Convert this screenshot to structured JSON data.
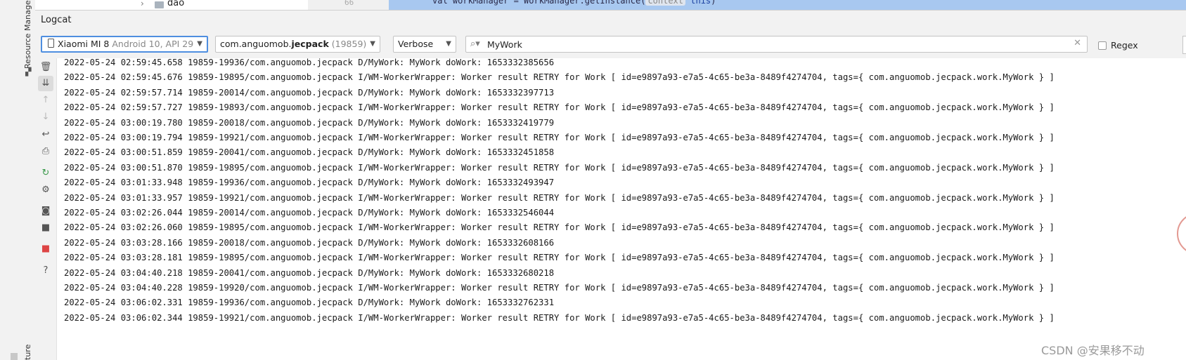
{
  "project_tree": {
    "item_label": "dao"
  },
  "editor": {
    "code_prefix": "val workManager = WorkManager.getInstance(",
    "param_hint": "context",
    "code_arg": "this",
    "code_suffix": ")"
  },
  "sidebar": {
    "resource_manager_label": "Resource Manager",
    "structure_label": "ture"
  },
  "logcat": {
    "title": "Logcat",
    "device": {
      "name": "Xiaomi MI 8",
      "details": "Android 10, API 29"
    },
    "app": {
      "package_prefix": "com.anguomob.",
      "package_bold": "jecpack",
      "pid": "(19859)"
    },
    "level": "Verbose",
    "filter_value": "MyWork",
    "regex_label": "Regex",
    "regex_checked": false,
    "lines": [
      "2022-05-24 02:59:45.658 19859-19936/com.anguomob.jecpack D/MyWork: MyWork doWork: 1653332385656",
      "2022-05-24 02:59:45.676 19859-19895/com.anguomob.jecpack I/WM-WorkerWrapper: Worker result RETRY for Work [ id=e9897a93-e7a5-4c65-be3a-8489f4274704, tags={ com.anguomob.jecpack.work.MyWork } ]",
      "2022-05-24 02:59:57.714 19859-20014/com.anguomob.jecpack D/MyWork: MyWork doWork: 1653332397713",
      "2022-05-24 02:59:57.727 19859-19893/com.anguomob.jecpack I/WM-WorkerWrapper: Worker result RETRY for Work [ id=e9897a93-e7a5-4c65-be3a-8489f4274704, tags={ com.anguomob.jecpack.work.MyWork } ]",
      "2022-05-24 03:00:19.780 19859-20018/com.anguomob.jecpack D/MyWork: MyWork doWork: 1653332419779",
      "2022-05-24 03:00:19.794 19859-19921/com.anguomob.jecpack I/WM-WorkerWrapper: Worker result RETRY for Work [ id=e9897a93-e7a5-4c65-be3a-8489f4274704, tags={ com.anguomob.jecpack.work.MyWork } ]",
      "2022-05-24 03:00:51.859 19859-20041/com.anguomob.jecpack D/MyWork: MyWork doWork: 1653332451858",
      "2022-05-24 03:00:51.870 19859-19895/com.anguomob.jecpack I/WM-WorkerWrapper: Worker result RETRY for Work [ id=e9897a93-e7a5-4c65-be3a-8489f4274704, tags={ com.anguomob.jecpack.work.MyWork } ]",
      "2022-05-24 03:01:33.948 19859-19936/com.anguomob.jecpack D/MyWork: MyWork doWork: 1653332493947",
      "2022-05-24 03:01:33.957 19859-19921/com.anguomob.jecpack I/WM-WorkerWrapper: Worker result RETRY for Work [ id=e9897a93-e7a5-4c65-be3a-8489f4274704, tags={ com.anguomob.jecpack.work.MyWork } ]",
      "2022-05-24 03:02:26.044 19859-20014/com.anguomob.jecpack D/MyWork: MyWork doWork: 1653332546044",
      "2022-05-24 03:02:26.060 19859-19895/com.anguomob.jecpack I/WM-WorkerWrapper: Worker result RETRY for Work [ id=e9897a93-e7a5-4c65-be3a-8489f4274704, tags={ com.anguomob.jecpack.work.MyWork } ]",
      "2022-05-24 03:03:28.166 19859-20018/com.anguomob.jecpack D/MyWork: MyWork doWork: 1653332608166",
      "2022-05-24 03:03:28.181 19859-19895/com.anguomob.jecpack I/WM-WorkerWrapper: Worker result RETRY for Work [ id=e9897a93-e7a5-4c65-be3a-8489f4274704, tags={ com.anguomob.jecpack.work.MyWork } ]",
      "2022-05-24 03:04:40.218 19859-20041/com.anguomob.jecpack D/MyWork: MyWork doWork: 1653332680218",
      "2022-05-24 03:04:40.228 19859-19920/com.anguomob.jecpack I/WM-WorkerWrapper: Worker result RETRY for Work [ id=e9897a93-e7a5-4c65-be3a-8489f4274704, tags={ com.anguomob.jecpack.work.MyWork } ]",
      "2022-05-24 03:06:02.331 19859-19936/com.anguomob.jecpack D/MyWork: MyWork doWork: 1653332762331",
      "2022-05-24 03:06:02.344 19859-19921/com.anguomob.jecpack I/WM-WorkerWrapper: Worker result RETRY for Work [ id=e9897a93-e7a5-4c65-be3a-8489f4274704, tags={ com.anguomob.jecpack.work.MyWork } ]"
    ]
  },
  "toolbar_icons": [
    "trash-icon",
    "scroll-to-end-icon",
    "arrow-up-icon",
    "arrow-down-icon",
    "soft-wrap-icon",
    "print-icon",
    "restart-icon",
    "settings-icon",
    "screenshot-icon",
    "screen-record-icon",
    "stop-icon",
    "help-icon"
  ],
  "colors": {
    "accent": "#4e8ee0",
    "editor_selection": "#a8c8f0",
    "panel": "#f2f2f2",
    "stop": "#dd4444",
    "restart": "#3a9a4a"
  },
  "watermark": "CSDN @安果移不动"
}
